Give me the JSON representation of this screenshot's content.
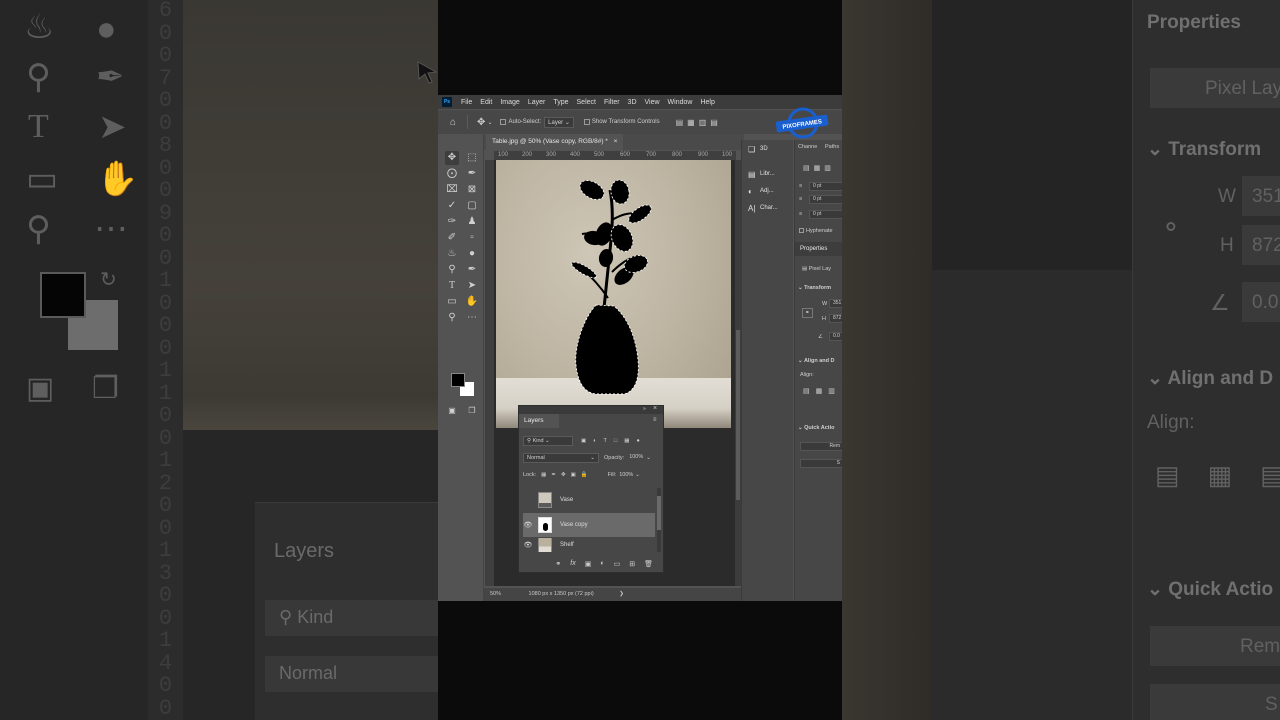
{
  "background": {
    "ruler_digits": "6\n0\n0\n7\n0\n0\n8\n0\n0\n9\n0\n0\n1\n0\n0\n0\n1\n1\n0\n0\n1\n2\n0\n0\n1\n3\n0\n0\n1\n4\n0\n0",
    "layers_title": "Layers",
    "kind_label": "Kind",
    "normal_label": "Normal",
    "properties_title": "Properties",
    "pixel_layer": "Pixel Lay",
    "transform": "Transform",
    "w_label": "W",
    "w_value": "351",
    "h_label": "H",
    "h_value": "872",
    "angle_value": "0.0",
    "align_title": "Align and D",
    "align_label": "Align:",
    "quick_actions": "Quick Actio",
    "remove_label": "Rem",
    "s_label": "S"
  },
  "menubar": {
    "logo": "Ps",
    "items": [
      "File",
      "Edit",
      "Image",
      "Layer",
      "Type",
      "Select",
      "Filter",
      "3D",
      "View",
      "Window",
      "Help"
    ]
  },
  "options": {
    "auto_select": "Auto-Select:",
    "auto_select_value": "Layer",
    "show_transform": "Show Transform Controls"
  },
  "badge_text": "PIXOFRAMES",
  "document": {
    "tab_title": "Table.jpg @ 50% (Vase copy, RGB/8#) *",
    "ruler_ticks": [
      "100",
      "200",
      "300",
      "400",
      "500",
      "600",
      "700",
      "800",
      "900",
      "100"
    ],
    "zoom": "50%",
    "doc_info": "1080 px x 1350 px (72 ppi)"
  },
  "layers_panel": {
    "title": "Layers",
    "kind": "Kind",
    "blend_mode": "Normal",
    "opacity_label": "Opacity:",
    "opacity_value": "100%",
    "lock_label": "Lock:",
    "fill_label": "Fill:",
    "fill_value": "100%",
    "layers": [
      {
        "name": "Vase",
        "visible": false,
        "selected": false
      },
      {
        "name": "Vase copy",
        "visible": true,
        "selected": true
      },
      {
        "name": "Shelf",
        "visible": true,
        "selected": false
      }
    ]
  },
  "dock": {
    "d3": "3D",
    "libraries": "Libr...",
    "adjustments": "Adj...",
    "character": "Char...",
    "channels": "Channe",
    "paths": "Paths",
    "pt1": "0 pt",
    "pt2": "0 pt",
    "pt3": "0 pt",
    "hyphenate": "Hyphenate",
    "properties": "Properties",
    "pixel_layer": "Pixel Lay",
    "transform": "Transform",
    "w_label": "W",
    "w_value": "351",
    "h_label": "H",
    "h_value": "872",
    "angle": "0.0",
    "align_title": "Align and D",
    "align_label": "Align:",
    "quick_actions": "Quick Actio",
    "remove": "Rem",
    "s": "S"
  },
  "colors": {
    "foreground": "#000000",
    "background": "#ffffff",
    "badge_blue": "#1a5fd0"
  }
}
